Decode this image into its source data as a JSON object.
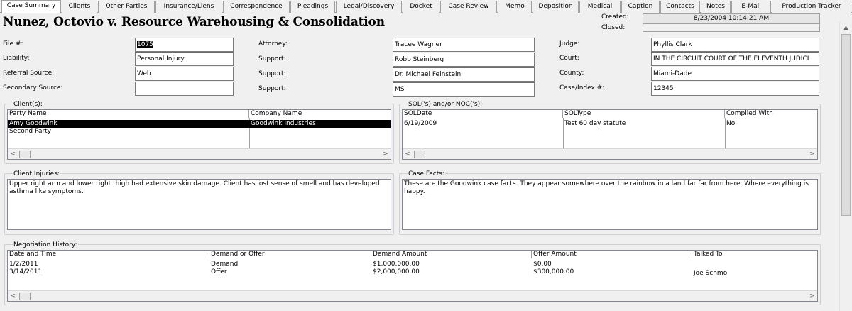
{
  "tabs": [
    {
      "label": "Case Summary",
      "active": true
    },
    {
      "label": "Clients"
    },
    {
      "label": "Other Parties"
    },
    {
      "label": "Insurance/Liens"
    },
    {
      "label": "Correspondence"
    },
    {
      "label": "Pleadings"
    },
    {
      "label": "Legal/Discovery"
    },
    {
      "label": "Docket"
    },
    {
      "label": "Case Review"
    },
    {
      "label": "Memo"
    },
    {
      "label": "Deposition"
    },
    {
      "label": "Medical"
    },
    {
      "label": "Caption"
    },
    {
      "label": "Contacts"
    },
    {
      "label": "Notes"
    },
    {
      "label": "E-Mail"
    },
    {
      "label": "Production Tracker"
    }
  ],
  "meta": {
    "created_label": "Created:",
    "created_value": "8/23/2004 10:14:21 AM",
    "closed_label": "Closed:",
    "closed_value": ""
  },
  "case_title": "Nunez, Octovio v. Resource Warehousing & Consolidation",
  "fields": {
    "file_label": "File #:",
    "file_value": "1075",
    "liability_label": "Liability:",
    "liability_value": "Personal Injury",
    "referral_label": "Referral Source:",
    "referral_value": "Web",
    "secondary_label": "Secondary Source:",
    "secondary_value": "",
    "attorney_label": "Attorney:",
    "attorney_value": "Tracee Wagner",
    "support1_label": "Support:",
    "support1_value": "Robb Steinberg",
    "support2_label": "Support:",
    "support2_value": "Dr. Michael Feinstein",
    "support3_label": "Support:",
    "support3_value": "MS",
    "judge_label": "Judge:",
    "judge_value": "Phyllis Clark",
    "court_label": "Court:",
    "court_value": "IN THE CIRCUIT COURT OF THE ELEVENTH JUDICI",
    "county_label": "County:",
    "county_value": "Miami-Dade",
    "caseindex_label": "Case/Index #:",
    "caseindex_value": "12345"
  },
  "clients": {
    "title": "Client(s):",
    "columns": [
      "Party Name",
      "Company Name"
    ],
    "rows": [
      [
        "Amy Goodwink",
        "Goodwink Industries"
      ],
      [
        "Second Party",
        ""
      ]
    ]
  },
  "sol": {
    "title": "SOL('s) and/or NOC('s):",
    "columns": [
      "SOLDate",
      "SOLType",
      "Complied With"
    ],
    "rows": [
      [
        "6/19/2009",
        "Test 60 day statute",
        "No"
      ]
    ]
  },
  "injuries": {
    "title": "Client Injuries:",
    "text": "Upper right arm and lower right thigh had extensive skin damage.  Client has lost sense of smell and has developed asthma like symptoms."
  },
  "facts": {
    "title": "Case Facts:",
    "text": "These are the Goodwink case facts.  They appear somewhere over the rainbow in a land far far from here.  Where everything is happy."
  },
  "negotiation": {
    "title": "Negotiation History:",
    "columns": [
      "Date and Time",
      "Demand or Offer",
      "Demand Amount",
      "Offer Amount",
      "Talked To"
    ],
    "rows": [
      [
        "1/2/2011",
        "Demand",
        "$1,000,000.00",
        "$0.00",
        ""
      ],
      [
        "3/14/2011",
        "Offer",
        "$2,000,000.00",
        "$300,000.00",
        "Joe Schmo"
      ]
    ]
  },
  "scroll": {
    "left_arrow": "<",
    "right_arrow": ">",
    "up_arrow": "▲"
  }
}
